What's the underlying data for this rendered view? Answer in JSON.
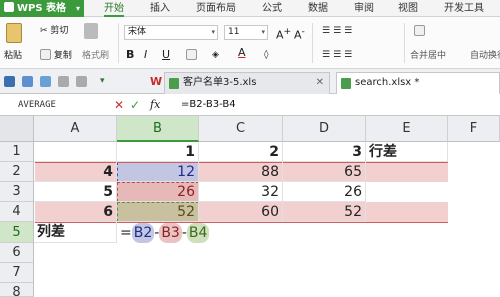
{
  "app": {
    "brand": "WPS 表格",
    "menu": [
      "开始",
      "插入",
      "页面布局",
      "公式",
      "数据",
      "审阅",
      "视图",
      "开发工具"
    ],
    "active_menu": "开始"
  },
  "ribbon": {
    "paste_label": "粘贴",
    "cut_label": "剪切",
    "copy_label": "复制",
    "format_painter_label": "格式刷",
    "font_name": "宋体",
    "font_size": "11",
    "merge_label": "合并居中",
    "wrap_label": "自动换行"
  },
  "tabs": [
    {
      "label": "客户名单3-5.xls",
      "active": false
    },
    {
      "label": "search.xlsx *",
      "active": true
    }
  ],
  "formula_bar": {
    "name_box": "AVERAGE",
    "cancel": "✕",
    "confirm": "✓",
    "fx": "fx",
    "formula": "=B2-B3-B4"
  },
  "grid": {
    "columns": [
      "A",
      "B",
      "C",
      "D",
      "E",
      "F"
    ],
    "rows": [
      "1",
      "2",
      "3",
      "4",
      "5",
      "6",
      "7",
      "8"
    ],
    "cells": {
      "B1": "1",
      "C1": "2",
      "D1": "3",
      "E1": "行差",
      "A2": "4",
      "B2": "12",
      "C2": "88",
      "D2": "65",
      "A3": "5",
      "B3": "26",
      "C3": "32",
      "D3": "26",
      "A4": "6",
      "B4": "52",
      "C4": "60",
      "D4": "52",
      "A5": "列差"
    },
    "editing": {
      "eq": "=",
      "t1": "B2",
      "m1": "-",
      "t2": "B3",
      "m2": "-",
      "t3": "B4"
    }
  },
  "colors": {
    "accent": "#3c9a3c",
    "highlight_row": "#f2d0d0",
    "ref_b2": "#c2c6e3",
    "ref_b3": "#e7b8b8",
    "ref_b4": "#c9c0a0"
  }
}
